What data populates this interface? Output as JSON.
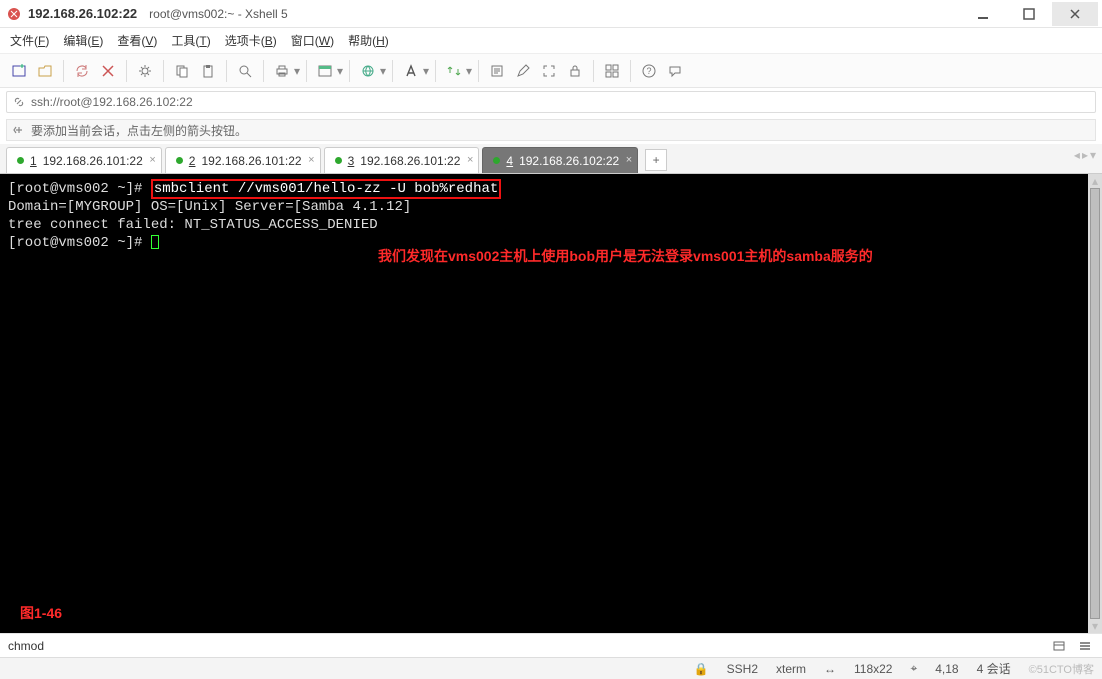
{
  "window": {
    "title": "192.168.26.102:22",
    "subtitle": "root@vms002:~ - Xshell 5"
  },
  "menus": [
    {
      "label": "文件",
      "hotkey": "F"
    },
    {
      "label": "编辑",
      "hotkey": "E"
    },
    {
      "label": "查看",
      "hotkey": "V"
    },
    {
      "label": "工具",
      "hotkey": "T"
    },
    {
      "label": "选项卡",
      "hotkey": "B"
    },
    {
      "label": "窗口",
      "hotkey": "W"
    },
    {
      "label": "帮助",
      "hotkey": "H"
    }
  ],
  "address": {
    "scheme_icon": "link-icon",
    "url": "ssh://root@192.168.26.102:22"
  },
  "info": {
    "icon": "info-icon",
    "text": "要添加当前会话，点击左侧的箭头按钮。"
  },
  "tabs": [
    {
      "num": "1",
      "label": "192.168.26.101:22",
      "active": false
    },
    {
      "num": "2",
      "label": "192.168.26.101:22",
      "active": false
    },
    {
      "num": "3",
      "label": "192.168.26.101:22",
      "active": false
    },
    {
      "num": "4",
      "label": "192.168.26.102:22",
      "active": true
    }
  ],
  "terminal": {
    "prompt1": "[root@vms002 ~]# ",
    "cmd": "smbclient //vms001/hello-zz -U bob%redhat",
    "line2": "Domain=[MYGROUP] OS=[Unix] Server=[Samba 4.1.12]",
    "line3": "tree connect failed: NT_STATUS_ACCESS_DENIED",
    "prompt2": "[root@vms002 ~]# ",
    "annotation": "我们发现在vms002主机上使用bob用户是无法登录vms001主机的samba服务的",
    "figure_label": "图1-46"
  },
  "bottom": {
    "text": "chmod"
  },
  "status": {
    "conn_icon": "lock-icon",
    "conn": "SSH2",
    "term": "xterm",
    "size_icon": "resize-icon",
    "size": "118x22",
    "pos_icon": "caret-pos-icon",
    "pos": "4,18",
    "sessions": "4 会话",
    "watermark": "©51CTO博客"
  },
  "toolbar_icons": [
    "new-session-icon",
    "open-session-icon",
    "sep",
    "reconnect-icon",
    "disconnect-icon",
    "sep",
    "properties-icon",
    "sep",
    "copy-icon",
    "paste-icon",
    "sep",
    "find-icon",
    "sep",
    "print-icon",
    "drop",
    "sep",
    "color-scheme-icon",
    "drop",
    "sep",
    "encoding-icon",
    "drop",
    "sep",
    "font-icon",
    "drop",
    "sep",
    "transfer-icon",
    "drop",
    "sep",
    "script-icon",
    "compose-icon",
    "fullscreen-icon",
    "lock-icon",
    "sep",
    "tile-icon",
    "sep",
    "help-icon",
    "chat-icon"
  ]
}
